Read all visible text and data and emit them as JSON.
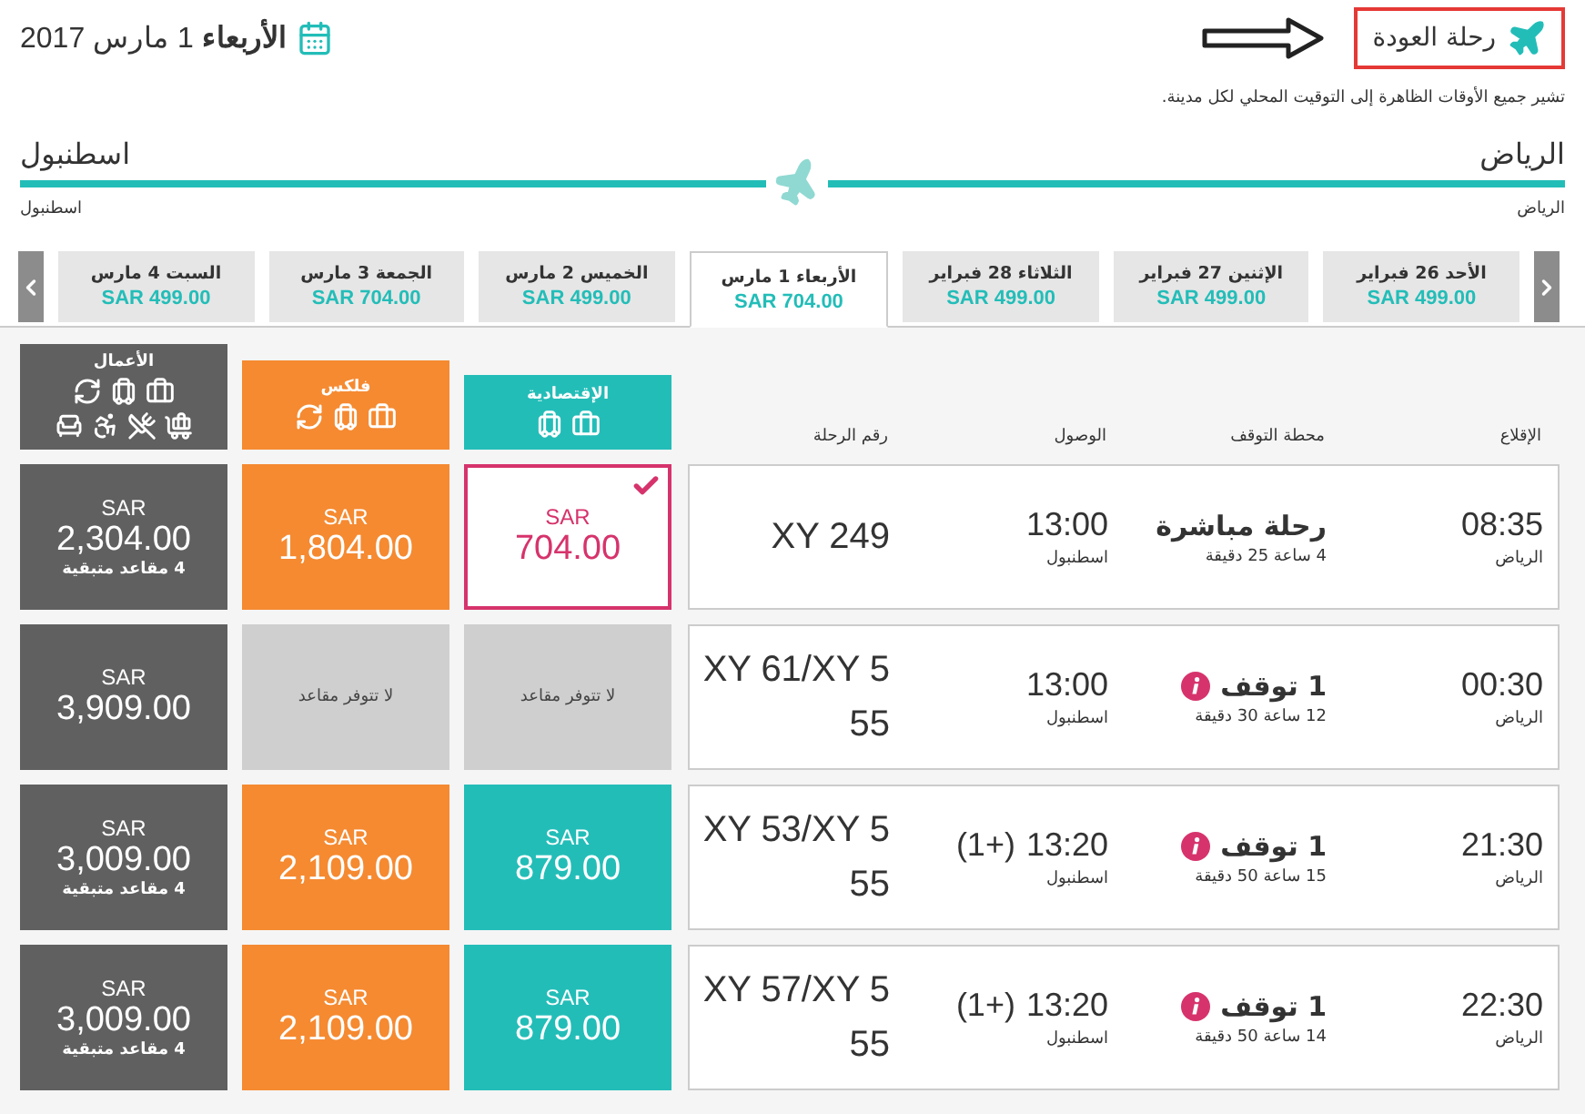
{
  "header": {
    "title": "رحلة العودة",
    "date": "**الأربعاء** 1 مارس 2017",
    "note": "تشير جميع الأوقات الظاهرة إلى التوقيت المحلي لكل مدينة."
  },
  "route": {
    "origin": "الرياض",
    "destination": "اسطنبول",
    "origin_small": "الرياض",
    "destination_small": "اسطنبول"
  },
  "date_tabs": [
    {
      "label": "الأحد 26 فبراير",
      "price": "SAR 499.00",
      "selected": false
    },
    {
      "label": "الإثنين 27 فبراير",
      "price": "SAR 499.00",
      "selected": false
    },
    {
      "label": "الثلاثاء 28 فبراير",
      "price": "SAR 499.00",
      "selected": false
    },
    {
      "label": "الأربعاء 1 مارس",
      "price": "SAR 704.00",
      "selected": true
    },
    {
      "label": "الخميس 2 مارس",
      "price": "SAR 499.00",
      "selected": false
    },
    {
      "label": "الجمعة 3 مارس",
      "price": "SAR 704.00",
      "selected": false
    },
    {
      "label": "السبت 4 مارس",
      "price": "SAR 499.00",
      "selected": false
    }
  ],
  "columns": [
    "الإقلاع",
    "محطة التوقف",
    "الوصول",
    "رقم الرحلة"
  ],
  "fare_classes": [
    {
      "kind": "economy",
      "name": "الإقتصادية",
      "color": "#23bdb8"
    },
    {
      "kind": "flex",
      "name": "فلكس",
      "color": "#f58a31"
    },
    {
      "kind": "business",
      "name": "الأعمال",
      "color": "#606060"
    }
  ],
  "flights": [
    {
      "departure": "08:35",
      "departure_city": "الرياض",
      "stop": "رحلة مباشرة",
      "has_info": false,
      "duration": "4 ساعة 25 دقيقة",
      "arrival": "13:00",
      "arrival_city": "اسطنبول",
      "flight_number": "XY 249",
      "fares": [
        {
          "kind": "price",
          "currency": "SAR",
          "amount": "704.00",
          "selected": true
        },
        {
          "kind": "price",
          "currency": "SAR",
          "amount": "1,804.00",
          "selected": false
        },
        {
          "kind": "price",
          "currency": "SAR",
          "amount": "2,304.00",
          "seats": "4 مقاعد متبقية",
          "selected": false
        }
      ]
    },
    {
      "departure": "00:30",
      "departure_city": "الرياض",
      "stop": "1 توقف",
      "has_info": true,
      "duration": "12 ساعة 30 دقيقة",
      "arrival": "13:00",
      "arrival_city": "اسطنبول",
      "flight_number": "XY 61/XY 555",
      "fares": [
        {
          "kind": "unavailable",
          "text": "لا تتوفر مقاعد",
          "selected": false
        },
        {
          "kind": "unavailable",
          "text": "لا تتوفر مقاعد",
          "selected": false
        },
        {
          "kind": "price",
          "currency": "SAR",
          "amount": "3,909.00",
          "selected": false
        }
      ]
    },
    {
      "departure": "21:30",
      "departure_city": "الرياض",
      "stop": "1 توقف",
      "has_info": true,
      "duration": "15 ساعة 50 دقيقة",
      "arrival": "13:20",
      "day_offset": "(1+)",
      "arrival_city": "اسطنبول",
      "flight_number": "XY 53/XY 555",
      "fares": [
        {
          "kind": "price",
          "currency": "SAR",
          "amount": "879.00",
          "selected": false
        },
        {
          "kind": "price",
          "currency": "SAR",
          "amount": "2,109.00",
          "selected": false
        },
        {
          "kind": "price",
          "currency": "SAR",
          "amount": "3,009.00",
          "seats": "4 مقاعد متبقية",
          "selected": false
        }
      ]
    },
    {
      "departure": "22:30",
      "departure_city": "الرياض",
      "stop": "1 توقف",
      "has_info": true,
      "duration": "14 ساعة 50 دقيقة",
      "arrival": "13:20",
      "day_offset": "(1+)",
      "arrival_city": "اسطنبول",
      "flight_number": "XY 57/XY 555",
      "fares": [
        {
          "kind": "price",
          "currency": "SAR",
          "amount": "879.00",
          "selected": false
        },
        {
          "kind": "price",
          "currency": "SAR",
          "amount": "2,109.00",
          "selected": false
        },
        {
          "kind": "price",
          "currency": "SAR",
          "amount": "3,009.00",
          "seats": "4 مقاعد متبقية",
          "selected": false
        }
      ]
    }
  ]
}
